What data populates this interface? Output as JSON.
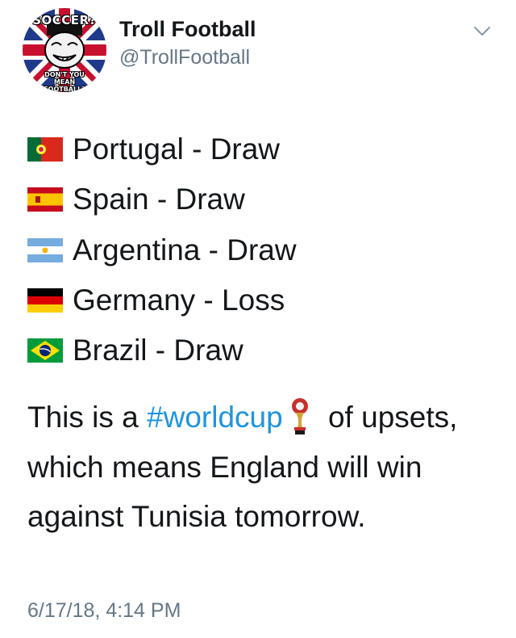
{
  "account": {
    "display_name": "Troll Football",
    "handle": "@TrollFootball",
    "avatar_text_top": "SOCCER?",
    "avatar_text_bottom": "DON'T YOU MEAN FOOTBALL?"
  },
  "menu_icon": "chevron-down-icon",
  "results": [
    {
      "flag": "portugal-flag-icon",
      "text": "Portugal - Draw"
    },
    {
      "flag": "spain-flag-icon",
      "text": "Spain - Draw"
    },
    {
      "flag": "argentina-flag-icon",
      "text": "Argentina - Draw"
    },
    {
      "flag": "germany-flag-icon",
      "text": "Germany - Loss"
    },
    {
      "flag": "brazil-flag-icon",
      "text": "Brazil - Draw"
    }
  ],
  "body": {
    "before_hashtag": "This is a ",
    "hashtag": "#worldcup",
    "trophy_icon": "world-cup-trophy-icon",
    "after_hashtag": " of upsets, which means England will win against Tunisia tomorrow."
  },
  "timestamp": "6/17/18, 4:14 PM",
  "colors": {
    "text": "#14171a",
    "muted": "#657786",
    "link": "#1b95e0"
  }
}
